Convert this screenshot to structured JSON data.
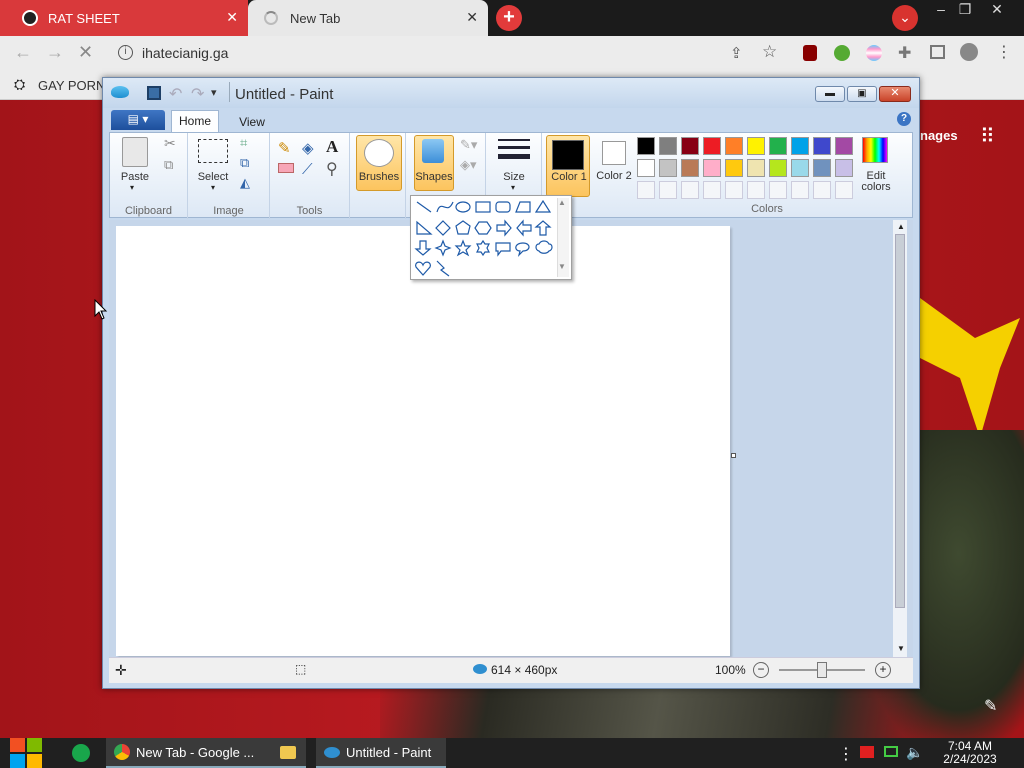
{
  "browser": {
    "tabs": [
      {
        "title": "RAT SHEET",
        "close": "✕"
      },
      {
        "title": "New Tab",
        "close": "✕"
      }
    ],
    "new_tab": "+",
    "url": "ihatecianig.ga",
    "bookmark_label": "GAY PORN",
    "page_right_link": "nages",
    "window_controls": [
      "–",
      "❐",
      "✕"
    ]
  },
  "paint": {
    "title": "Untitled - Paint",
    "tabs": [
      "Home",
      "View"
    ],
    "groups": {
      "clipboard": "Clipboard",
      "image": "Image",
      "tools": "Tools",
      "colors": "Colors"
    },
    "buttons": {
      "paste": "Paste",
      "select": "Select",
      "brushes": "Brushes",
      "shapes": "Shapes",
      "size": "Size",
      "color1": "Color 1",
      "color2": "Color 2",
      "edit_colors": "Edit colors"
    },
    "status": {
      "dimensions": "614 × 460px",
      "zoom": "100%"
    },
    "palette_row1": [
      "#000000",
      "#7f7f7f",
      "#880015",
      "#ed1c24",
      "#ff7f27",
      "#fff200",
      "#22b14c",
      "#00a2e8",
      "#3f48cc",
      "#a349a4"
    ],
    "palette_row2": [
      "#ffffff",
      "#c3c3c3",
      "#b97a57",
      "#ffaec9",
      "#ffc90e",
      "#efe4b0",
      "#b5e61d",
      "#99d9ea",
      "#7092be",
      "#c8bfe7"
    ]
  },
  "taskbar": {
    "items": [
      "New Tab - Google ...",
      "Untitled - Paint"
    ],
    "time": "7:04 AM",
    "date": "2/24/2023"
  }
}
